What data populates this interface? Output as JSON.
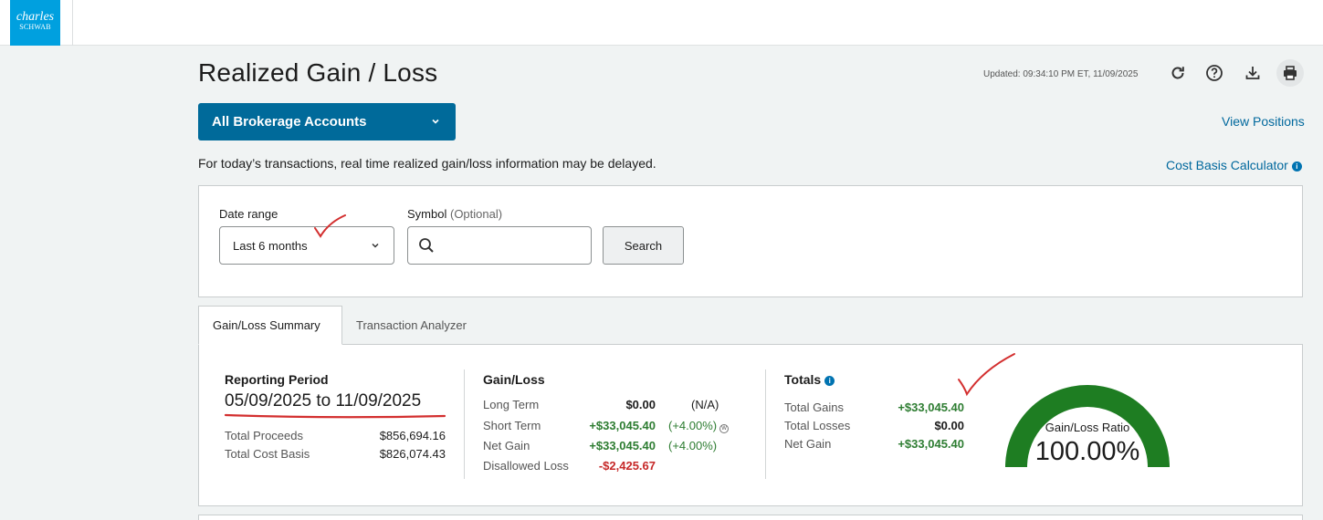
{
  "brand": {
    "line1": "charles",
    "line2": "SCHWAB"
  },
  "header": {
    "title": "Realized Gain / Loss",
    "updated": "Updated: 09:34:10 PM ET, 11/09/2025"
  },
  "account_select": {
    "label": "All Brokerage Accounts"
  },
  "links": {
    "view_positions": "View Positions",
    "cost_basis_calculator": "Cost Basis Calculator"
  },
  "notice": "For today’s transactions, real time realized gain/loss information may be delayed.",
  "search": {
    "date_range_label": "Date range",
    "date_range_value": "Last 6 months",
    "symbol_label": "Symbol",
    "symbol_optional": "(Optional)",
    "symbol_value": "",
    "button": "Search"
  },
  "tabs": [
    {
      "label": "Gain/Loss Summary",
      "active": true
    },
    {
      "label": "Transaction Analyzer",
      "active": false
    }
  ],
  "reporting": {
    "title": "Reporting Period",
    "period": "05/09/2025 to 11/09/2025",
    "rows": [
      {
        "label": "Total Proceeds",
        "value": "$856,694.16"
      },
      {
        "label": "Total Cost Basis",
        "value": "$826,074.43"
      }
    ]
  },
  "gainloss": {
    "title": "Gain/Loss",
    "long_term": {
      "label": "Long Term",
      "value": "$0.00",
      "pct": "(N/A)"
    },
    "short_term": {
      "label": "Short Term",
      "value": "+$33,045.40",
      "pct": "(+4.00%)"
    },
    "net_gain": {
      "label": "Net Gain",
      "value": "+$33,045.40",
      "pct": "(+4.00%)"
    },
    "disallowed": {
      "label": "Disallowed Loss",
      "value": "-$2,425.67"
    }
  },
  "totals": {
    "title": "Totals",
    "total_gains": {
      "label": "Total Gains",
      "value": "+$33,045.40"
    },
    "total_losses": {
      "label": "Total Losses",
      "value": "$0.00"
    },
    "net_gain": {
      "label": "Net Gain",
      "value": "+$33,045.40"
    }
  },
  "gauge": {
    "label": "Gain/Loss Ratio",
    "value": "100.00%",
    "ratio": 1.0,
    "color": "#1e7d22"
  },
  "colors": {
    "brand_blue": "#00a0df",
    "primary": "#006a9a",
    "gain": "#2e7d32",
    "loss": "#c62828",
    "annotation": "#d32f2f"
  },
  "icons": [
    "refresh-icon",
    "help-icon",
    "download-icon",
    "print-icon",
    "search-icon",
    "chevron-down-icon",
    "info-icon"
  ]
}
